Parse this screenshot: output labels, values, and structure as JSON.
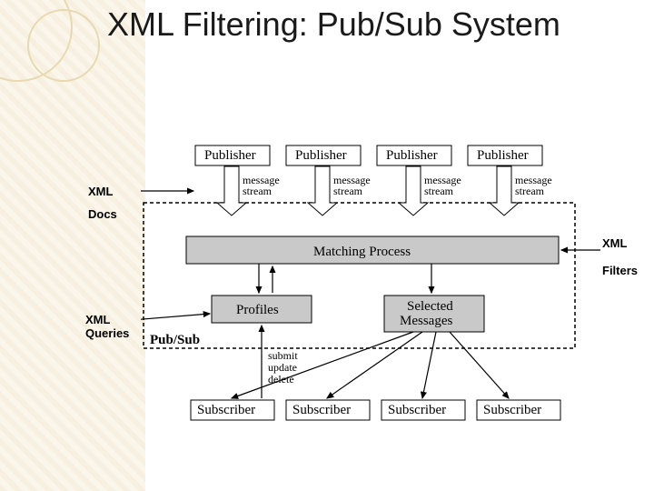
{
  "title": "XML Filtering: Pub/Sub System",
  "annotations": {
    "docs_l1": "XML",
    "docs_l2": "Docs",
    "filters_l1": "XML",
    "filters_l2": "Filters",
    "queries_l1": "XML",
    "queries_l2": "Queries"
  },
  "diagram": {
    "pubsub_label": "Pub/Sub",
    "publishers": [
      "Publisher",
      "Publisher",
      "Publisher",
      "Publisher"
    ],
    "stream_l1": "message",
    "stream_l2": "stream",
    "matching": "Matching Process",
    "profiles": "Profiles",
    "selected_l1": "Selected",
    "selected_l2": "Messages",
    "ops_l1": "submit",
    "ops_l2": "update",
    "ops_l3": "delete",
    "subscribers": [
      "Subscriber",
      "Subscriber",
      "Subscriber",
      "Subscriber"
    ]
  }
}
